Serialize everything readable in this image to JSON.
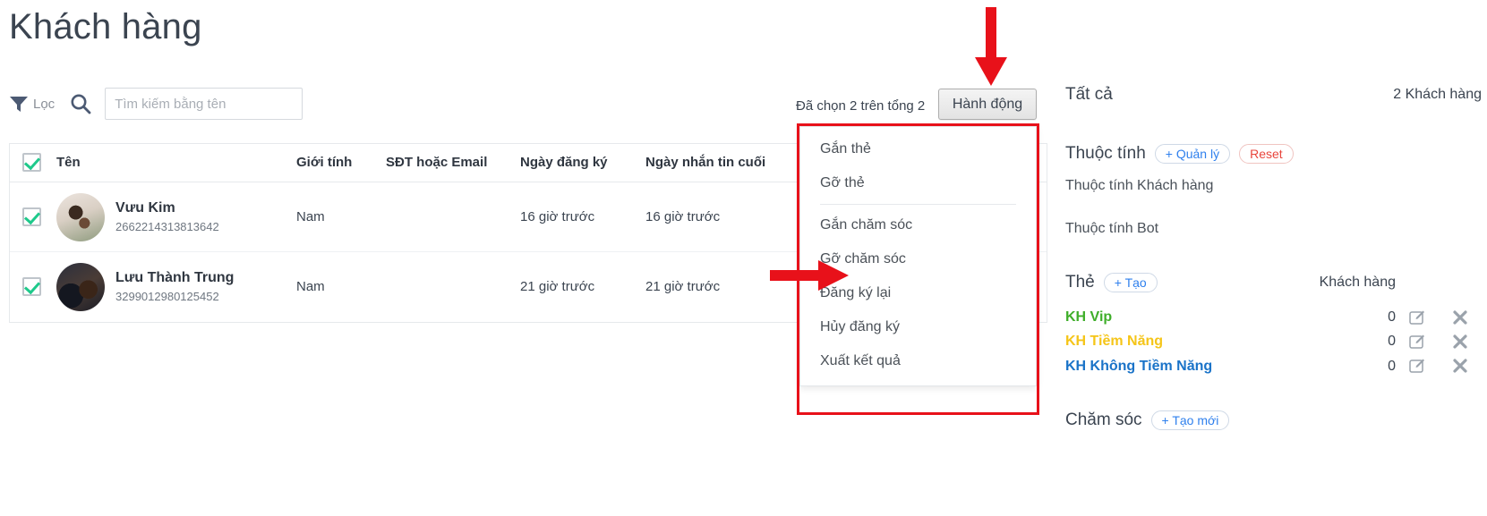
{
  "page": {
    "title": "Khách hàng"
  },
  "toolbar": {
    "filter_label": "Lọc",
    "filter_icon": "filter-icon",
    "search_icon": "search-icon",
    "search_placeholder": "Tìm kiếm bằng tên",
    "search_value": ""
  },
  "selection": {
    "info": "Đã chọn 2 trên tổng 2",
    "action_button": "Hành động"
  },
  "table": {
    "columns": [
      "Tên",
      "Giới tính",
      "SĐT hoặc Email",
      "Ngày đăng ký",
      "Ngày nhắn tin cuối"
    ],
    "header_checkbox_checked": true,
    "rows": [
      {
        "checked": true,
        "name": "Vưu Kim",
        "id": "2662214313813642",
        "gender": "Nam",
        "contact": "",
        "registered": "16 giờ trước",
        "last_message": "16 giờ trước"
      },
      {
        "checked": true,
        "name": "Lưu Thành Trung",
        "id": "3299012980125452",
        "gender": "Nam",
        "contact": "",
        "registered": "21 giờ trước",
        "last_message": "21 giờ trước"
      }
    ]
  },
  "dropdown": {
    "items": [
      {
        "label": "Gắn thẻ",
        "separator_after": false
      },
      {
        "label": "Gỡ thẻ",
        "separator_after": true
      },
      {
        "label": "Gắn chăm sóc",
        "separator_after": false
      },
      {
        "label": "Gỡ chăm sóc",
        "separator_after": false
      },
      {
        "label": "Đăng ký lại",
        "separator_after": false
      },
      {
        "label": "Hủy đăng ký",
        "separator_after": false
      },
      {
        "label": "Xuất kết quả",
        "separator_after": false
      }
    ]
  },
  "right_panel": {
    "all_label": "Tất cả",
    "count_label": "2 Khách hàng",
    "attributes": {
      "title": "Thuộc tính",
      "manage_label": "+ Quản lý",
      "reset_label": "Reset",
      "items": [
        "Thuộc tính Khách hàng",
        "Thuộc tính Bot"
      ]
    },
    "tags": {
      "title": "Thẻ",
      "create_label": "+ Tạo",
      "column_label": "Khách hàng",
      "rows": [
        {
          "name": "KH Vip",
          "color": "#3fae2a",
          "count": "0"
        },
        {
          "name": "KH Tiềm Năng",
          "color": "#f5c518",
          "count": "0"
        },
        {
          "name": "KH Không Tiềm Năng",
          "color": "#1a73c8",
          "count": "0"
        }
      ]
    },
    "care": {
      "title": "Chăm sóc",
      "create_label": "+ Tạo mới"
    }
  },
  "annotations": {
    "arrow_color": "#e8111a",
    "highlight_color": "#e8111a",
    "arrow_down_target": "Hành động",
    "arrow_right_target": "Gỡ chăm sóc"
  }
}
